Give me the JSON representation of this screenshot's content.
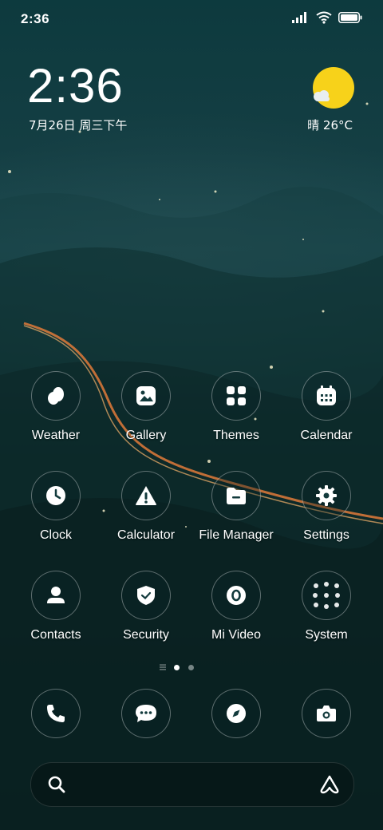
{
  "status_bar": {
    "time": "2:36",
    "icons": [
      "signal-icon",
      "wifi-icon",
      "battery-icon"
    ]
  },
  "clock_widget": {
    "time": "2:36",
    "date": "7月26日 周三下午",
    "weather": "晴 26°C",
    "weather_icon": "sunny-icon"
  },
  "apps": [
    {
      "label": "Weather",
      "icon": "weather-icon"
    },
    {
      "label": "Gallery",
      "icon": "gallery-icon"
    },
    {
      "label": "Themes",
      "icon": "themes-icon"
    },
    {
      "label": "Calendar",
      "icon": "calendar-icon"
    },
    {
      "label": "Clock",
      "icon": "clock-icon"
    },
    {
      "label": "Calculator",
      "icon": "calculator-icon"
    },
    {
      "label": "File Manager",
      "icon": "file-manager-icon"
    },
    {
      "label": "Settings",
      "icon": "gear-icon"
    },
    {
      "label": "Contacts",
      "icon": "contacts-icon"
    },
    {
      "label": "Security",
      "icon": "shield-icon"
    },
    {
      "label": "Mi Video",
      "icon": "video-icon"
    },
    {
      "label": "System",
      "icon": "folder-icon"
    }
  ],
  "pager": {
    "pages": 2,
    "current": 1
  },
  "dock": [
    "phone-icon",
    "messages-icon",
    "browser-icon",
    "camera-icon"
  ],
  "search_bar": {
    "left_icon": "search-icon",
    "right_icon": "assistant-icon"
  },
  "colors": {
    "accent_sun": "#f7d21a",
    "icon_white": "#ffffff"
  }
}
